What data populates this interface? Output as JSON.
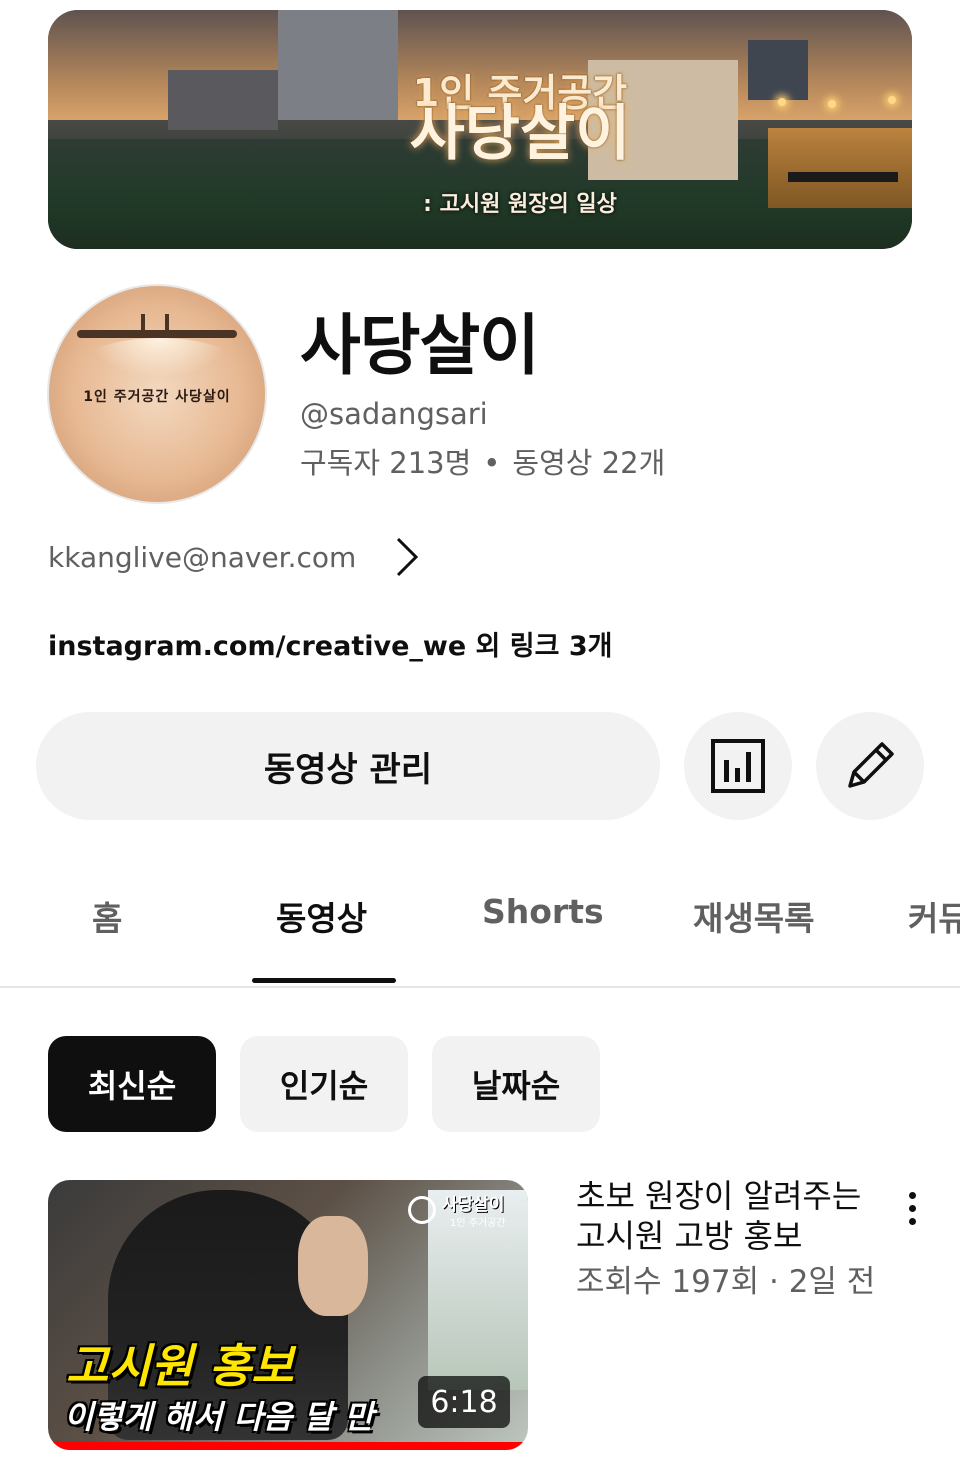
{
  "banner": {
    "line1": "1인 주거공간",
    "line2": "사당살이",
    "line3": ": 고시원 원장의 일상"
  },
  "avatar": {
    "sign_text": "1인 주거공간 사당살이"
  },
  "channel": {
    "name": "사당살이",
    "handle": "@sadangsari",
    "subscribers": "구독자 213명",
    "separator": "•",
    "videos": "동영상 22개",
    "email": "kkanglive@naver.com",
    "links": "instagram.com/creative_we 외 링크 3개"
  },
  "actions": {
    "manage_label": "동영상 관리",
    "analytics_icon": "bar-chart-icon",
    "edit_icon": "pencil-icon"
  },
  "tabs": [
    {
      "label": "홈"
    },
    {
      "label": "동영상"
    },
    {
      "label": "Shorts"
    },
    {
      "label": "재생목록"
    },
    {
      "label": "커뮤"
    }
  ],
  "sort_chips": [
    {
      "label": "최신순",
      "selected": true
    },
    {
      "label": "인기순",
      "selected": false
    },
    {
      "label": "날짜순",
      "selected": false
    }
  ],
  "video": {
    "title": "초보 원장이 알려주는 고시원 고방 홍보",
    "views": "조회수 197회",
    "meta_sep": "·",
    "age": "2일 전",
    "duration": "6:18",
    "thumb_title1": "고시원 홍보",
    "thumb_title2": "이렇게 해서 다음 달 만",
    "thumb_logo": "사당살이",
    "thumb_logo_sub": "1인 주거공간"
  },
  "colors": {
    "text_primary": "#0f0f0f",
    "text_secondary": "#606060",
    "chip_bg": "#f2f2f2",
    "progress_red": "#ff0000"
  }
}
